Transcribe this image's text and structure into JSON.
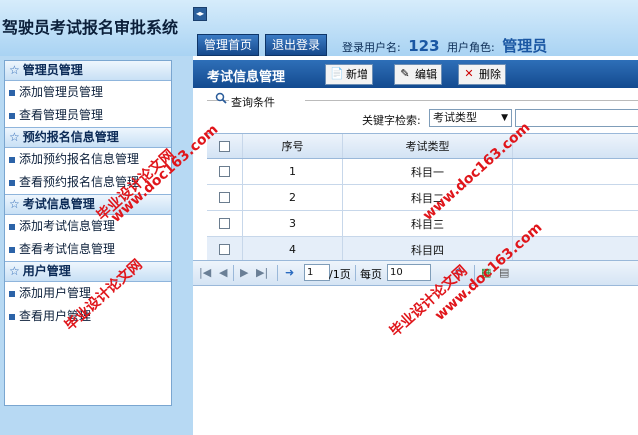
{
  "app": {
    "title": "驾驶员考试报名审批系统",
    "nav": {
      "home": "管理首页",
      "logout": "退出登录"
    },
    "user": {
      "name_label": "登录用户名:",
      "name": "123",
      "role_label": "用户角色:",
      "role": "管理员"
    }
  },
  "sidebar": {
    "sections": [
      {
        "title": "管理员管理",
        "items": [
          "添加管理员管理",
          "查看管理员管理"
        ]
      },
      {
        "title": "预约报名信息管理",
        "items": [
          "添加预约报名信息管理",
          "查看预约报名信息管理"
        ]
      },
      {
        "title": "考试信息管理",
        "items": [
          "添加考试信息管理",
          "查看考试信息管理"
        ]
      },
      {
        "title": "用户管理",
        "items": [
          "添加用户管理",
          "查看用户管理"
        ]
      }
    ]
  },
  "main": {
    "title": "考试信息管理",
    "toolbar": {
      "add": "新增",
      "edit": "编辑",
      "delete": "删除"
    },
    "filter": {
      "legend": "查询条件",
      "keyword_label": "关键字检索:",
      "keyword_select": "考试类型"
    },
    "table": {
      "headers": [
        "序号",
        "考试类型"
      ],
      "rows": [
        {
          "no": "1",
          "type": "科目一"
        },
        {
          "no": "2",
          "type": "科目二"
        },
        {
          "no": "3",
          "type": "科目三"
        },
        {
          "no": "4",
          "type": "科目四"
        }
      ]
    },
    "pager": {
      "page": "1",
      "total_pages": "/1页",
      "per_page_label": "每页",
      "per_page": "10"
    }
  },
  "watermarks": [
    "毕业设计论文网",
    "www.doc163.com",
    "毕业设计论文网",
    "www.doc163.com",
    "www.doc163.com",
    "毕业设计论文网"
  ],
  "colors": {
    "header_blue": "#134a8f",
    "sidebar_bg": "#b7d9f3",
    "watermark": "#e0161b"
  }
}
